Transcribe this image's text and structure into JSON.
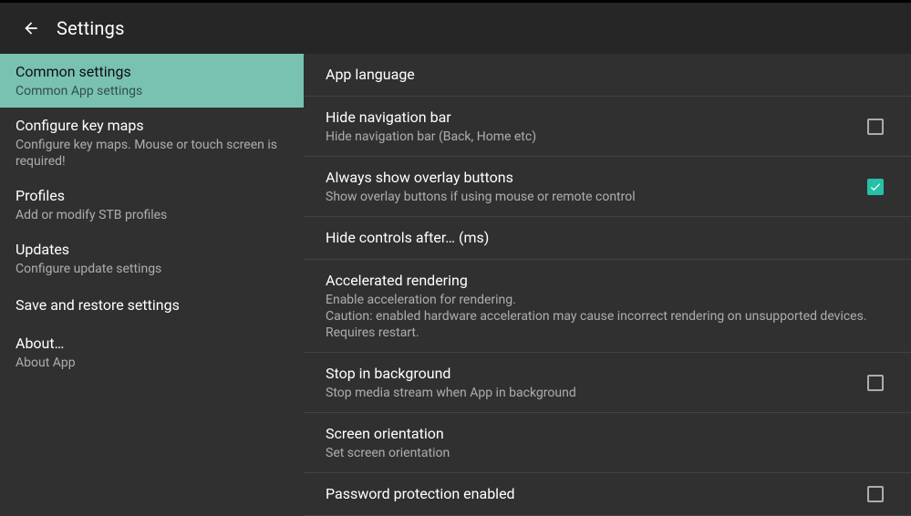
{
  "header": {
    "title": "Settings"
  },
  "sidebar": {
    "items": [
      {
        "title": "Common settings",
        "subtitle": "Common App settings",
        "selected": true
      },
      {
        "title": "Configure key maps",
        "subtitle": "Configure key maps. Mouse or touch screen is required!"
      },
      {
        "title": "Profiles",
        "subtitle": "Add or modify STB profiles"
      },
      {
        "title": "Updates",
        "subtitle": "Configure update settings"
      },
      {
        "title": "Save and restore settings",
        "subtitle": ""
      },
      {
        "title": "About…",
        "subtitle": "About App"
      }
    ]
  },
  "main": {
    "prefs": [
      {
        "title": "App language",
        "subtitle": "",
        "checkbox": null
      },
      {
        "title": "Hide navigation bar",
        "subtitle": "Hide navigation bar (Back, Home etc)",
        "checkbox": false
      },
      {
        "title": "Always show overlay buttons",
        "subtitle": "Show overlay buttons if using mouse or remote control",
        "checkbox": true
      },
      {
        "title": "Hide controls after… (ms)",
        "subtitle": "",
        "checkbox": null
      },
      {
        "title": "Accelerated rendering",
        "subtitle": "Enable acceleration for rendering.\nCaution: enabled hardware acceleration may cause incorrect rendering on unsupported devices. Requires restart.",
        "checkbox": null
      },
      {
        "title": "Stop in background",
        "subtitle": "Stop media stream when App in background",
        "checkbox": false
      },
      {
        "title": "Screen orientation",
        "subtitle": "Set screen orientation",
        "checkbox": null
      },
      {
        "title": "Password protection enabled",
        "subtitle": "",
        "checkbox": false
      }
    ]
  }
}
